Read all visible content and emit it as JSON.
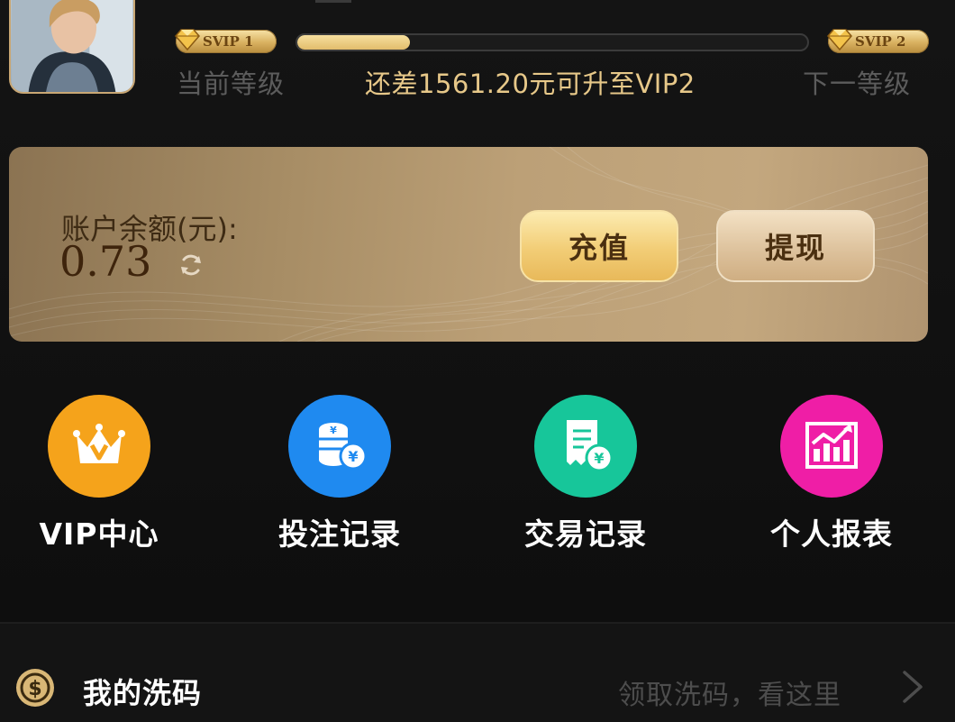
{
  "vip": {
    "current_badge": "SVIP 1",
    "next_badge": "SVIP 2",
    "current_label": "当前等级",
    "next_label": "下一等级",
    "upgrade_tip": "还差1561.20元可升至VIP2",
    "progress_fraction": 0.22
  },
  "balance": {
    "label": "账户余额(元):",
    "amount": "0.73",
    "recharge_label": "充值",
    "withdraw_label": "提现"
  },
  "actions": [
    {
      "label": "VIP中心",
      "icon": "crown-icon",
      "color": "#f5a31b"
    },
    {
      "label": "投注记录",
      "icon": "coins-icon",
      "color": "#1f8af0"
    },
    {
      "label": "交易记录",
      "icon": "receipt-icon",
      "color": "#17c69a"
    },
    {
      "label": "个人报表",
      "icon": "chart-icon",
      "color": "#ef1ea6"
    }
  ],
  "wash": {
    "title": "我的洗码",
    "hint": "领取洗码，看这里"
  },
  "colors": {
    "gold_text": "#e7c889",
    "background": "#101010"
  }
}
